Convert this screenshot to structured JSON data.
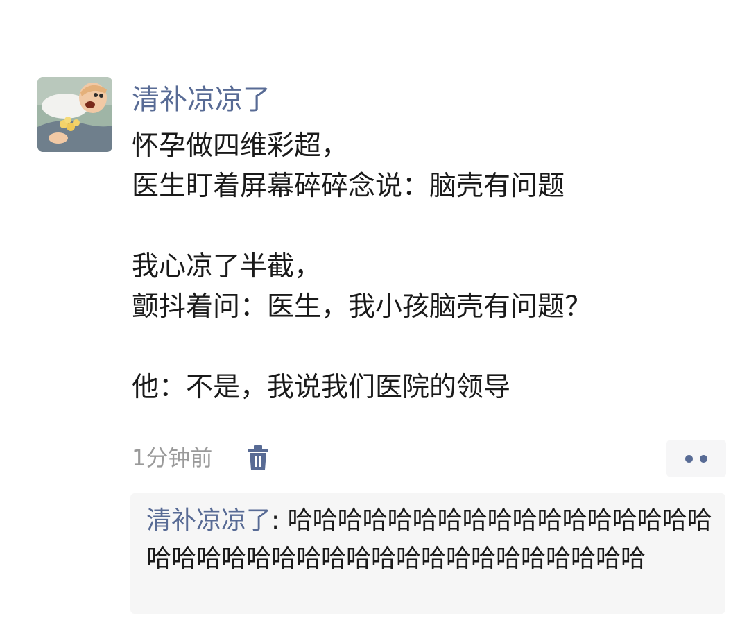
{
  "post": {
    "username": "清补凉凉了",
    "content_lines": [
      "怀孕做四维彩超，",
      "医生盯着屏幕碎碎念说：脑壳有问题",
      "",
      "我心凉了半截，",
      "颤抖着问：医生，我小孩脑壳有问题？",
      "",
      "他：不是，我说我们医院的领导"
    ],
    "time": "1分钟前",
    "icons": {
      "avatar": "avatar-cartoon-icon",
      "delete": "trash-icon",
      "more": "more-dots-icon"
    }
  },
  "comment": {
    "author": "清补凉凉了",
    "separator": ": ",
    "text": "哈哈哈哈哈哈哈哈哈哈哈哈哈哈哈哈哈哈哈哈哈哈哈哈哈哈哈哈哈哈哈哈哈哈哈哈哈"
  },
  "colors": {
    "link_blue": "#586b95",
    "meta_gray": "#9a9a9a",
    "panel_bg": "#f6f6f6"
  }
}
